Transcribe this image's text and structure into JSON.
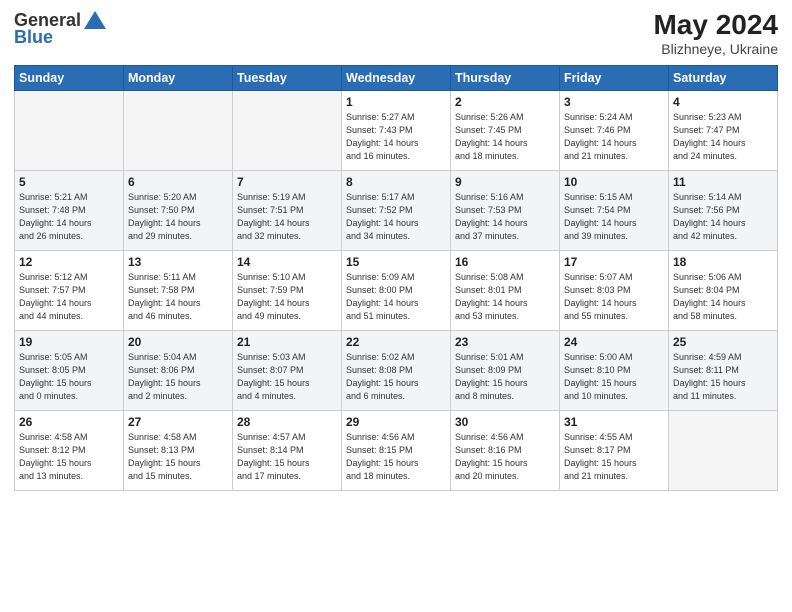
{
  "header": {
    "logo_line1": "General",
    "logo_line2": "Blue",
    "title": "May 2024",
    "location": "Blizhneye, Ukraine"
  },
  "days_of_week": [
    "Sunday",
    "Monday",
    "Tuesday",
    "Wednesday",
    "Thursday",
    "Friday",
    "Saturday"
  ],
  "weeks": [
    [
      {
        "day": "",
        "info": ""
      },
      {
        "day": "",
        "info": ""
      },
      {
        "day": "",
        "info": ""
      },
      {
        "day": "1",
        "info": "Sunrise: 5:27 AM\nSunset: 7:43 PM\nDaylight: 14 hours\nand 16 minutes."
      },
      {
        "day": "2",
        "info": "Sunrise: 5:26 AM\nSunset: 7:45 PM\nDaylight: 14 hours\nand 18 minutes."
      },
      {
        "day": "3",
        "info": "Sunrise: 5:24 AM\nSunset: 7:46 PM\nDaylight: 14 hours\nand 21 minutes."
      },
      {
        "day": "4",
        "info": "Sunrise: 5:23 AM\nSunset: 7:47 PM\nDaylight: 14 hours\nand 24 minutes."
      }
    ],
    [
      {
        "day": "5",
        "info": "Sunrise: 5:21 AM\nSunset: 7:48 PM\nDaylight: 14 hours\nand 26 minutes."
      },
      {
        "day": "6",
        "info": "Sunrise: 5:20 AM\nSunset: 7:50 PM\nDaylight: 14 hours\nand 29 minutes."
      },
      {
        "day": "7",
        "info": "Sunrise: 5:19 AM\nSunset: 7:51 PM\nDaylight: 14 hours\nand 32 minutes."
      },
      {
        "day": "8",
        "info": "Sunrise: 5:17 AM\nSunset: 7:52 PM\nDaylight: 14 hours\nand 34 minutes."
      },
      {
        "day": "9",
        "info": "Sunrise: 5:16 AM\nSunset: 7:53 PM\nDaylight: 14 hours\nand 37 minutes."
      },
      {
        "day": "10",
        "info": "Sunrise: 5:15 AM\nSunset: 7:54 PM\nDaylight: 14 hours\nand 39 minutes."
      },
      {
        "day": "11",
        "info": "Sunrise: 5:14 AM\nSunset: 7:56 PM\nDaylight: 14 hours\nand 42 minutes."
      }
    ],
    [
      {
        "day": "12",
        "info": "Sunrise: 5:12 AM\nSunset: 7:57 PM\nDaylight: 14 hours\nand 44 minutes."
      },
      {
        "day": "13",
        "info": "Sunrise: 5:11 AM\nSunset: 7:58 PM\nDaylight: 14 hours\nand 46 minutes."
      },
      {
        "day": "14",
        "info": "Sunrise: 5:10 AM\nSunset: 7:59 PM\nDaylight: 14 hours\nand 49 minutes."
      },
      {
        "day": "15",
        "info": "Sunrise: 5:09 AM\nSunset: 8:00 PM\nDaylight: 14 hours\nand 51 minutes."
      },
      {
        "day": "16",
        "info": "Sunrise: 5:08 AM\nSunset: 8:01 PM\nDaylight: 14 hours\nand 53 minutes."
      },
      {
        "day": "17",
        "info": "Sunrise: 5:07 AM\nSunset: 8:03 PM\nDaylight: 14 hours\nand 55 minutes."
      },
      {
        "day": "18",
        "info": "Sunrise: 5:06 AM\nSunset: 8:04 PM\nDaylight: 14 hours\nand 58 minutes."
      }
    ],
    [
      {
        "day": "19",
        "info": "Sunrise: 5:05 AM\nSunset: 8:05 PM\nDaylight: 15 hours\nand 0 minutes."
      },
      {
        "day": "20",
        "info": "Sunrise: 5:04 AM\nSunset: 8:06 PM\nDaylight: 15 hours\nand 2 minutes."
      },
      {
        "day": "21",
        "info": "Sunrise: 5:03 AM\nSunset: 8:07 PM\nDaylight: 15 hours\nand 4 minutes."
      },
      {
        "day": "22",
        "info": "Sunrise: 5:02 AM\nSunset: 8:08 PM\nDaylight: 15 hours\nand 6 minutes."
      },
      {
        "day": "23",
        "info": "Sunrise: 5:01 AM\nSunset: 8:09 PM\nDaylight: 15 hours\nand 8 minutes."
      },
      {
        "day": "24",
        "info": "Sunrise: 5:00 AM\nSunset: 8:10 PM\nDaylight: 15 hours\nand 10 minutes."
      },
      {
        "day": "25",
        "info": "Sunrise: 4:59 AM\nSunset: 8:11 PM\nDaylight: 15 hours\nand 11 minutes."
      }
    ],
    [
      {
        "day": "26",
        "info": "Sunrise: 4:58 AM\nSunset: 8:12 PM\nDaylight: 15 hours\nand 13 minutes."
      },
      {
        "day": "27",
        "info": "Sunrise: 4:58 AM\nSunset: 8:13 PM\nDaylight: 15 hours\nand 15 minutes."
      },
      {
        "day": "28",
        "info": "Sunrise: 4:57 AM\nSunset: 8:14 PM\nDaylight: 15 hours\nand 17 minutes."
      },
      {
        "day": "29",
        "info": "Sunrise: 4:56 AM\nSunset: 8:15 PM\nDaylight: 15 hours\nand 18 minutes."
      },
      {
        "day": "30",
        "info": "Sunrise: 4:56 AM\nSunset: 8:16 PM\nDaylight: 15 hours\nand 20 minutes."
      },
      {
        "day": "31",
        "info": "Sunrise: 4:55 AM\nSunset: 8:17 PM\nDaylight: 15 hours\nand 21 minutes."
      },
      {
        "day": "",
        "info": ""
      }
    ]
  ]
}
